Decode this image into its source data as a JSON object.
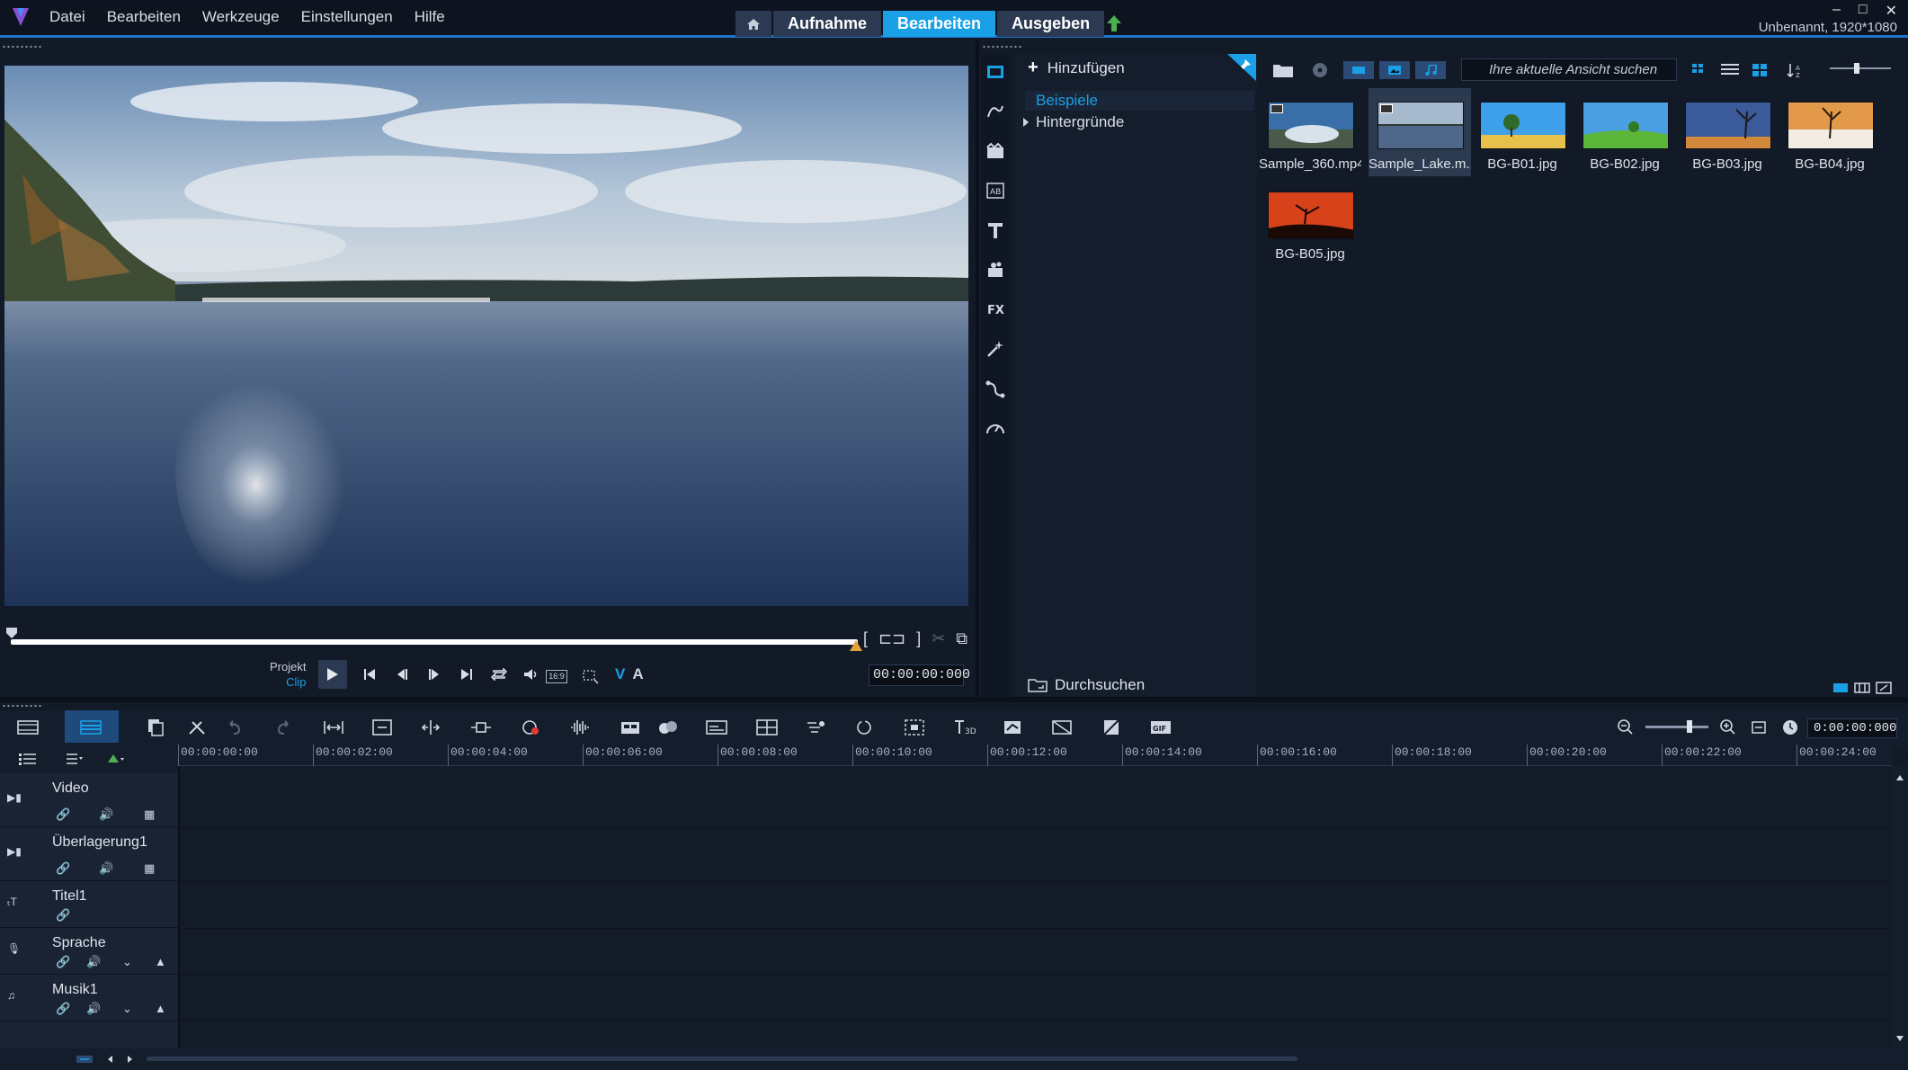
{
  "menu": [
    "Datei",
    "Bearbeiten",
    "Werkzeuge",
    "Einstellungen",
    "Hilfe"
  ],
  "modes": {
    "capture": "Aufnahme",
    "edit": "Bearbeiten",
    "share": "Ausgeben"
  },
  "window": {
    "project_info": "Unbenannt, 1920*1080",
    "minimize": "–",
    "maximize": "□",
    "close": "✕"
  },
  "player": {
    "project_label": "Projekt",
    "clip_label": "Clip",
    "timecode": "00:00:00:000",
    "aspect_ratio": "16:9",
    "video_toggle": "V",
    "audio_toggle": "A"
  },
  "library": {
    "add_label": "Hinzufügen",
    "tree": [
      "Beispiele",
      "Hintergründe"
    ],
    "browse_label": "Durchsuchen",
    "search_placeholder": "Ihre aktuelle Ansicht suchen",
    "items": [
      {
        "label": "Sample_360.mp4",
        "kind": "video"
      },
      {
        "label": "Sample_Lake.m...",
        "kind": "video",
        "selected": true
      },
      {
        "label": "BG-B01.jpg",
        "kind": "image"
      },
      {
        "label": "BG-B02.jpg",
        "kind": "image"
      },
      {
        "label": "BG-B03.jpg",
        "kind": "image"
      },
      {
        "label": "BG-B04.jpg",
        "kind": "image"
      },
      {
        "label": "BG-B05.jpg",
        "kind": "image"
      }
    ]
  },
  "timeline": {
    "timecode": "0:00:00:000",
    "ruler": [
      "00:00:00:00",
      "00:00:02:00",
      "00:00:04:00",
      "00:00:06:00",
      "00:00:08:00",
      "00:00:10:00",
      "00:00:12:00",
      "00:00:14:00",
      "00:00:16:00",
      "00:00:18:00",
      "00:00:20:00",
      "00:00:22:00",
      "00:00:24:00"
    ],
    "tracks": [
      {
        "name": "Video",
        "icon": "camera-icon"
      },
      {
        "name": "Überlagerung1",
        "icon": "overlay-camera-icon"
      },
      {
        "name": "Titel1",
        "icon": "title-icon"
      },
      {
        "name": "Sprache",
        "icon": "microphone-icon"
      },
      {
        "name": "Musik1",
        "icon": "music-icon"
      }
    ]
  },
  "colors": {
    "accent": "#1aa0e6",
    "background": "#121a27",
    "panel": "#141d2c"
  }
}
